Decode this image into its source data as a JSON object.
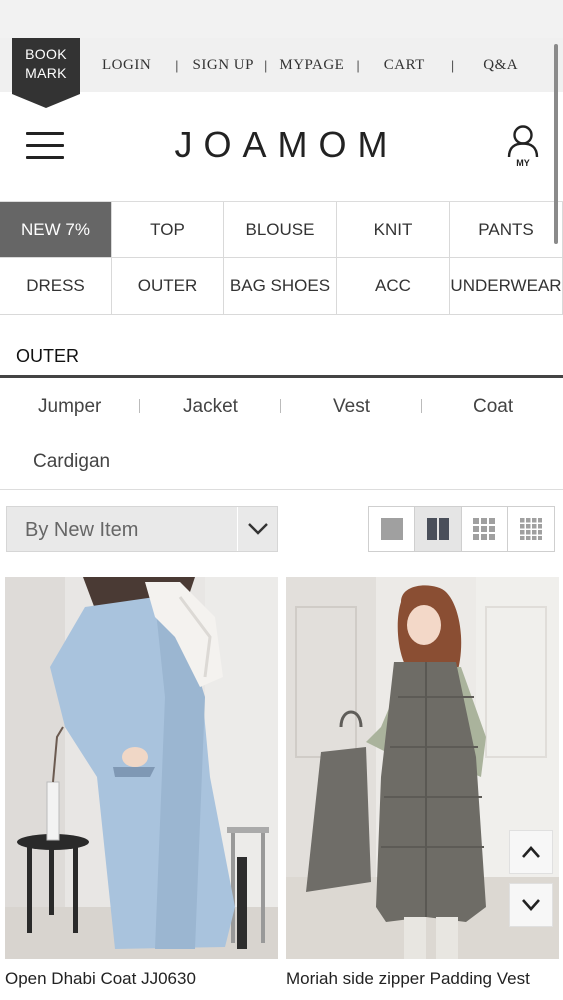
{
  "utility": {
    "bookmark_line1": "BOOK",
    "bookmark_line2": "MARK",
    "links": [
      "LOGIN",
      "SIGN UP",
      "MYPAGE",
      "CART",
      "Q&A"
    ]
  },
  "header": {
    "logo": "JOAMOM",
    "my_label": "MY"
  },
  "categories": [
    "NEW 7%",
    "TOP",
    "BLOUSE",
    "KNIT",
    "PANTS",
    "DRESS",
    "OUTER",
    "BAG SHOES",
    "ACC",
    "UNDERWEAR"
  ],
  "section": {
    "title": "OUTER",
    "subcategories": [
      "Jumper",
      "Jacket",
      "Vest",
      "Coat",
      "Cardigan"
    ]
  },
  "sort": {
    "selected": "By New Item"
  },
  "view": {
    "active_index": 1
  },
  "products": [
    {
      "name": "Open Dhabi Coat JJ0630"
    },
    {
      "name": "Moriah side zipper Padding Vest"
    }
  ],
  "colors": {
    "active_category": "#666666",
    "text": "#222222"
  }
}
